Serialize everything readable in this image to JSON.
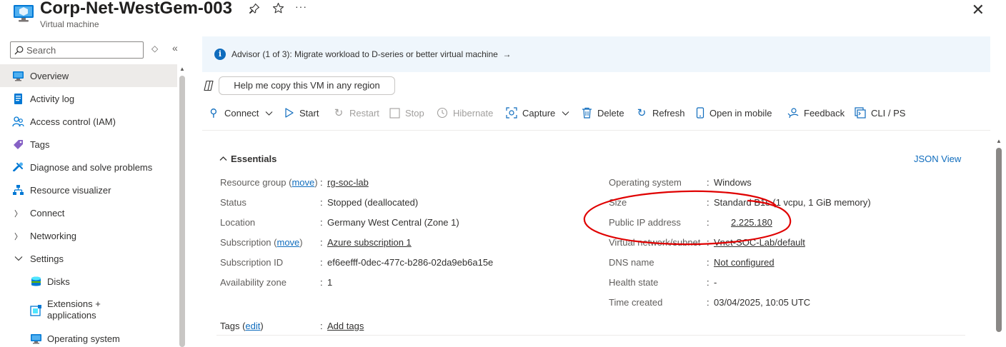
{
  "header": {
    "title": "Corp-Net-WestGem-003",
    "subtitle": "Virtual machine",
    "pin_icon": "pin-icon",
    "star_icon": "star-icon",
    "more_glyph": "···",
    "close_glyph": "✕"
  },
  "sidebar": {
    "search_placeholder": "Search",
    "items": [
      {
        "label": "Overview",
        "icon": "overview-icon"
      },
      {
        "label": "Activity log",
        "icon": "activity-log-icon"
      },
      {
        "label": "Access control (IAM)",
        "icon": "people-icon"
      },
      {
        "label": "Tags",
        "icon": "tag-icon"
      },
      {
        "label": "Diagnose and solve problems",
        "icon": "wrench-icon"
      },
      {
        "label": "Resource visualizer",
        "icon": "hierarchy-icon"
      },
      {
        "label": "Connect"
      },
      {
        "label": "Networking"
      },
      {
        "label": "Settings"
      },
      {
        "label": "Disks",
        "icon": "disk-icon"
      },
      {
        "label_line1": "Extensions +",
        "label_line2": "applications",
        "icon": "extension-icon"
      },
      {
        "label": "Operating system",
        "icon": "monitor-icon"
      }
    ]
  },
  "advisor": {
    "text": "Advisor (1 of 3): Migrate workload to D-series or better virtual machine",
    "arrow": "→"
  },
  "copilot": {
    "button_label": "Help me copy this VM in any region"
  },
  "toolbar": {
    "connect": "Connect",
    "start": "Start",
    "restart": "Restart",
    "stop": "Stop",
    "hibernate": "Hibernate",
    "capture": "Capture",
    "delete": "Delete",
    "refresh": "Refresh",
    "open_in_mobile": "Open in mobile",
    "feedback": "Feedback",
    "cli_ps": "CLI / PS"
  },
  "essentials": {
    "title": "Essentials",
    "json_view": "JSON View",
    "left": {
      "resource_group_label": "Resource group",
      "move_link": "move",
      "resource_group_value": "rg-soc-lab",
      "status_label": "Status",
      "status_value": "Stopped (deallocated)",
      "location_label": "Location",
      "location_value": "Germany West Central (Zone 1)",
      "subscription_label": "Subscription",
      "subscription_value": "Azure subscription 1",
      "subscription_id_label": "Subscription ID",
      "subscription_id_value": "ef6eefff-0dec-477c-b286-02da9eb6a15e",
      "availability_zone_label": "Availability zone",
      "availability_zone_value": "1"
    },
    "right": {
      "os_label": "Operating system",
      "os_value": "Windows",
      "size_label": "Size",
      "size_value": "Standard B1s (1 vcpu, 1 GiB memory)",
      "public_ip_label": "Public IP address",
      "public_ip_value": "2.225.180",
      "vnet_label": "Virtual network/subnet",
      "vnet_value": "Vnet-SOC-Lab/default",
      "dns_label": "DNS name",
      "dns_value": "Not configured",
      "health_label": "Health state",
      "health_value": "-",
      "time_created_label": "Time created",
      "time_created_value": "03/04/2025, 10:05 UTC"
    },
    "tags_label": "Tags",
    "tags_edit": "edit",
    "tags_value": "Add tags"
  },
  "colors": {
    "accent": "#0f6cbd",
    "annotation": "#e00000",
    "advisor_bg": "#eff6fc"
  }
}
